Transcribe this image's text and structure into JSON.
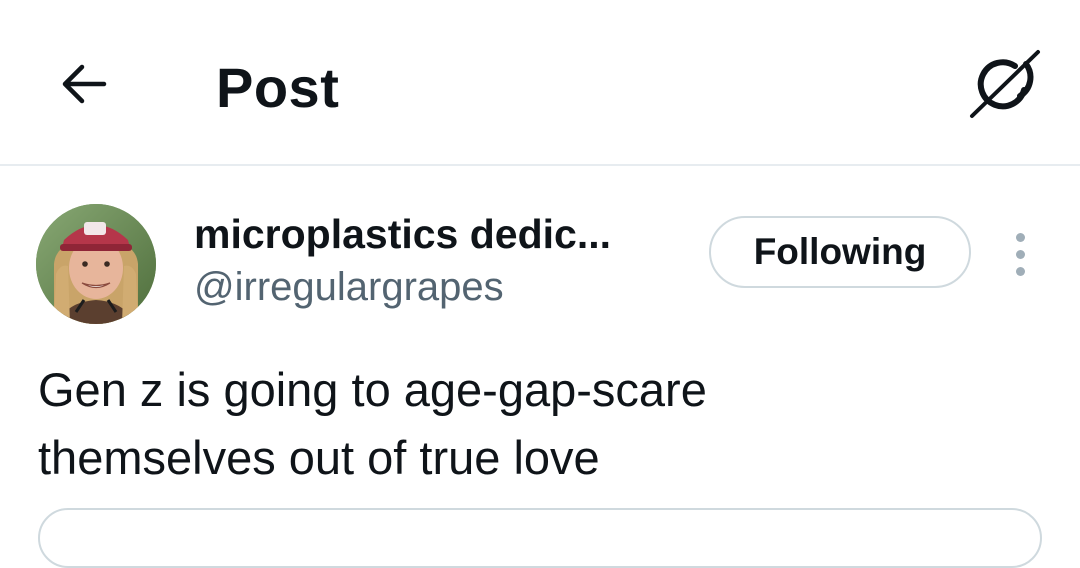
{
  "header": {
    "title": "Post",
    "back_icon": "arrow-left-icon",
    "grok_icon": "grok-slash-circle-icon"
  },
  "author": {
    "display_name": "microplastics dedic...",
    "handle": "@irregulargrapes",
    "avatar": "avatar-photo"
  },
  "follow_button": {
    "label": "Following"
  },
  "more_icon": "more-vertical-icon",
  "post": {
    "text": "Gen z is going to age-gap-scare\nthemselves out of true love"
  },
  "colors": {
    "text_primary": "#0f1419",
    "text_secondary": "#536471",
    "border": "#cfd9de",
    "divider": "#e7ecf0"
  }
}
